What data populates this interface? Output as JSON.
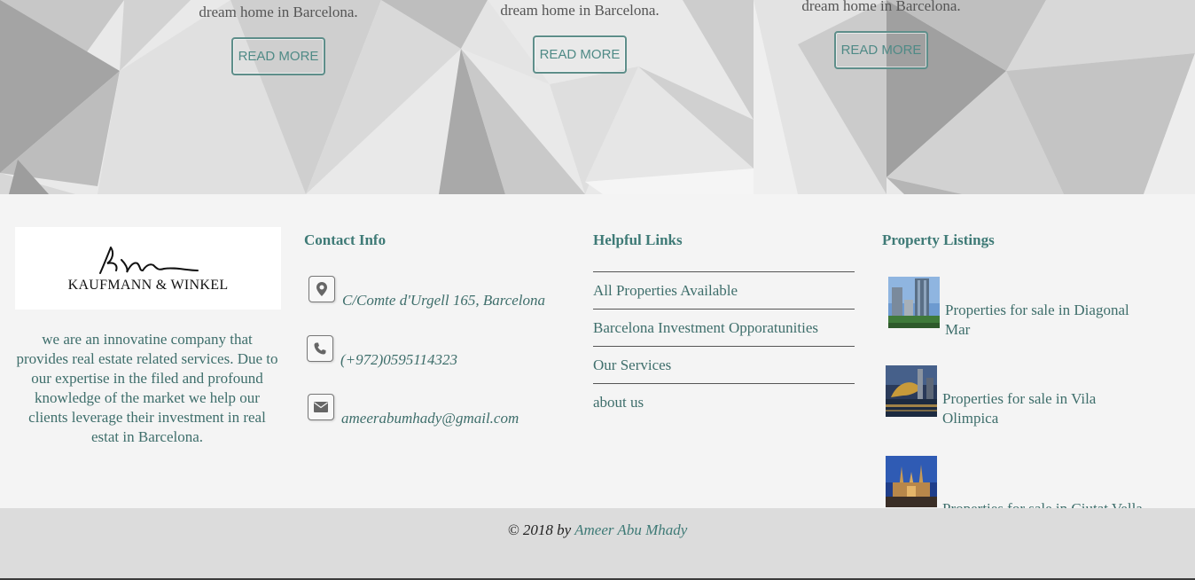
{
  "hero": {
    "cards": [
      {
        "desc": "dream home in Barcelona.",
        "button": "READ MORE"
      },
      {
        "desc": "dream home in Barcelona.",
        "button": "READ MORE"
      },
      {
        "desc": "dream home in Barcelona.",
        "button": "READ MORE"
      }
    ]
  },
  "footer": {
    "logo": {
      "text": "KAUFMANN & WINKEL"
    },
    "about": "we are an innovatine company that provides real estate related services. Due to our expertise in the filed and profound knowledge of the market we help our clients leverage their investment in real estat in Barcelona.",
    "contact": {
      "heading": "Contact Info",
      "address": "C/Comte d'Urgell 165, Barcelona",
      "phone": "(+972)0595114323",
      "email": "ameerabumhady@gmail.com",
      "icons": [
        "map-marker-icon",
        "phone-icon",
        "envelope-icon"
      ]
    },
    "links": {
      "heading": "Helpful Links",
      "items": [
        "All Properties Available",
        "Barcelona Investment Opporatunities",
        "Our Services",
        "about us"
      ]
    },
    "listings": {
      "heading": "Property Listings",
      "items": [
        "Properties for sale in Diagonal Mar",
        "Properties for sale in Vila Olimpica",
        "Properties for sale in Ciutat Vella"
      ]
    }
  },
  "copyright": {
    "prefix": "© 2018 by",
    "author": "Ameer Abu Mhady"
  },
  "colors": {
    "accent": "#3e7a76",
    "footer_bg": "#f4f4f4",
    "copyright_bg": "#dcdcdc"
  }
}
